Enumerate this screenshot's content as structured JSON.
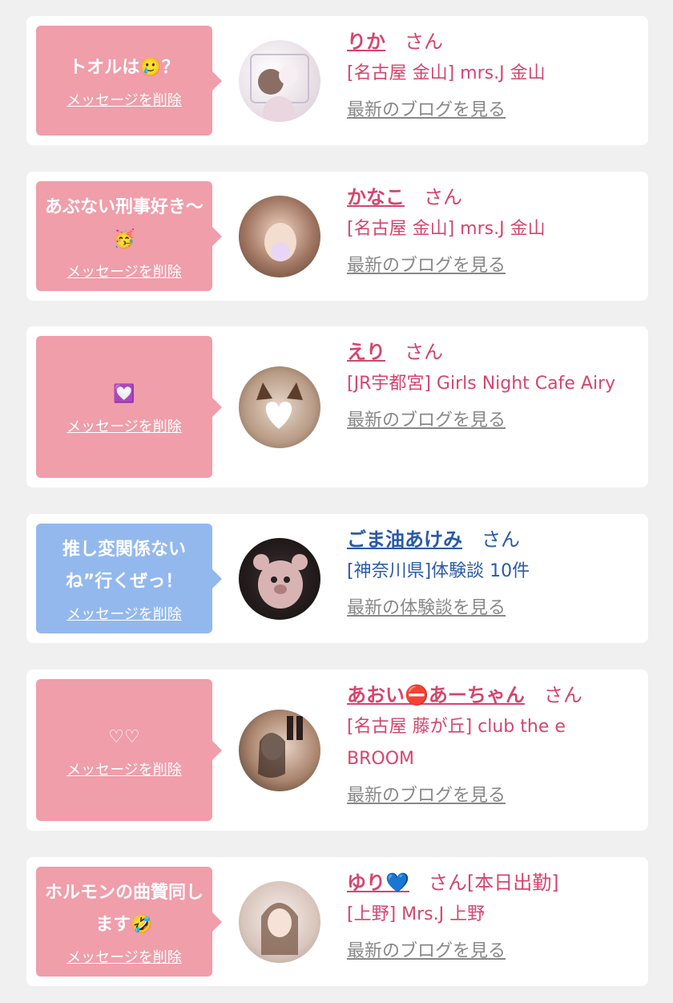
{
  "colors": {
    "pink_bubble": "#ef9eaa",
    "blue_bubble": "#93b8ee",
    "pink_text": "#d6456d",
    "blue_text": "#2a5aa8",
    "link_gray": "#888888"
  },
  "cards": [
    {
      "theme": "pink",
      "message": "トオルは🥲？",
      "delete_label": "メッセージを削除",
      "name": "りか",
      "honorific": "さん",
      "shop": "[名古屋 金山] mrs.J 金山",
      "link": "最新のブログを見る"
    },
    {
      "theme": "pink",
      "message": "あぶない刑事好き〜🥳",
      "delete_label": "メッセージを削除",
      "name": "かなこ",
      "honorific": "さん",
      "shop": "[名古屋 金山] mrs.J 金山",
      "link": "最新のブログを見る"
    },
    {
      "theme": "pink",
      "message": "💟",
      "delete_label": "メッセージを削除",
      "name": "えり",
      "honorific": "さん",
      "shop": "[JR宇都宮] Girls Night Cafe Airy",
      "link": "最新のブログを見る"
    },
    {
      "theme": "blue",
      "message": "推し変関係ないね”行くぜっ！",
      "delete_label": "メッセージを削除",
      "name": "ごま油あけみ",
      "honorific": "さん",
      "shop": "[神奈川県]体験談 10件",
      "link": "最新の体験談を見る"
    },
    {
      "theme": "pink",
      "message": "♡♡",
      "delete_label": "メッセージを削除",
      "name": "あおい⛔あーちゃん",
      "honorific": "さん",
      "shop": "[名古屋 藤が丘] club the e BROOM",
      "link": "最新のブログを見る"
    },
    {
      "theme": "pink",
      "message": "ホルモンの曲贊同します🤣",
      "delete_label": "メッセージを削除",
      "name": "ゆり💙",
      "honorific": "さん[本日出勤]",
      "shop": "[上野] Mrs.J 上野",
      "link": "最新のブログを見る"
    }
  ]
}
